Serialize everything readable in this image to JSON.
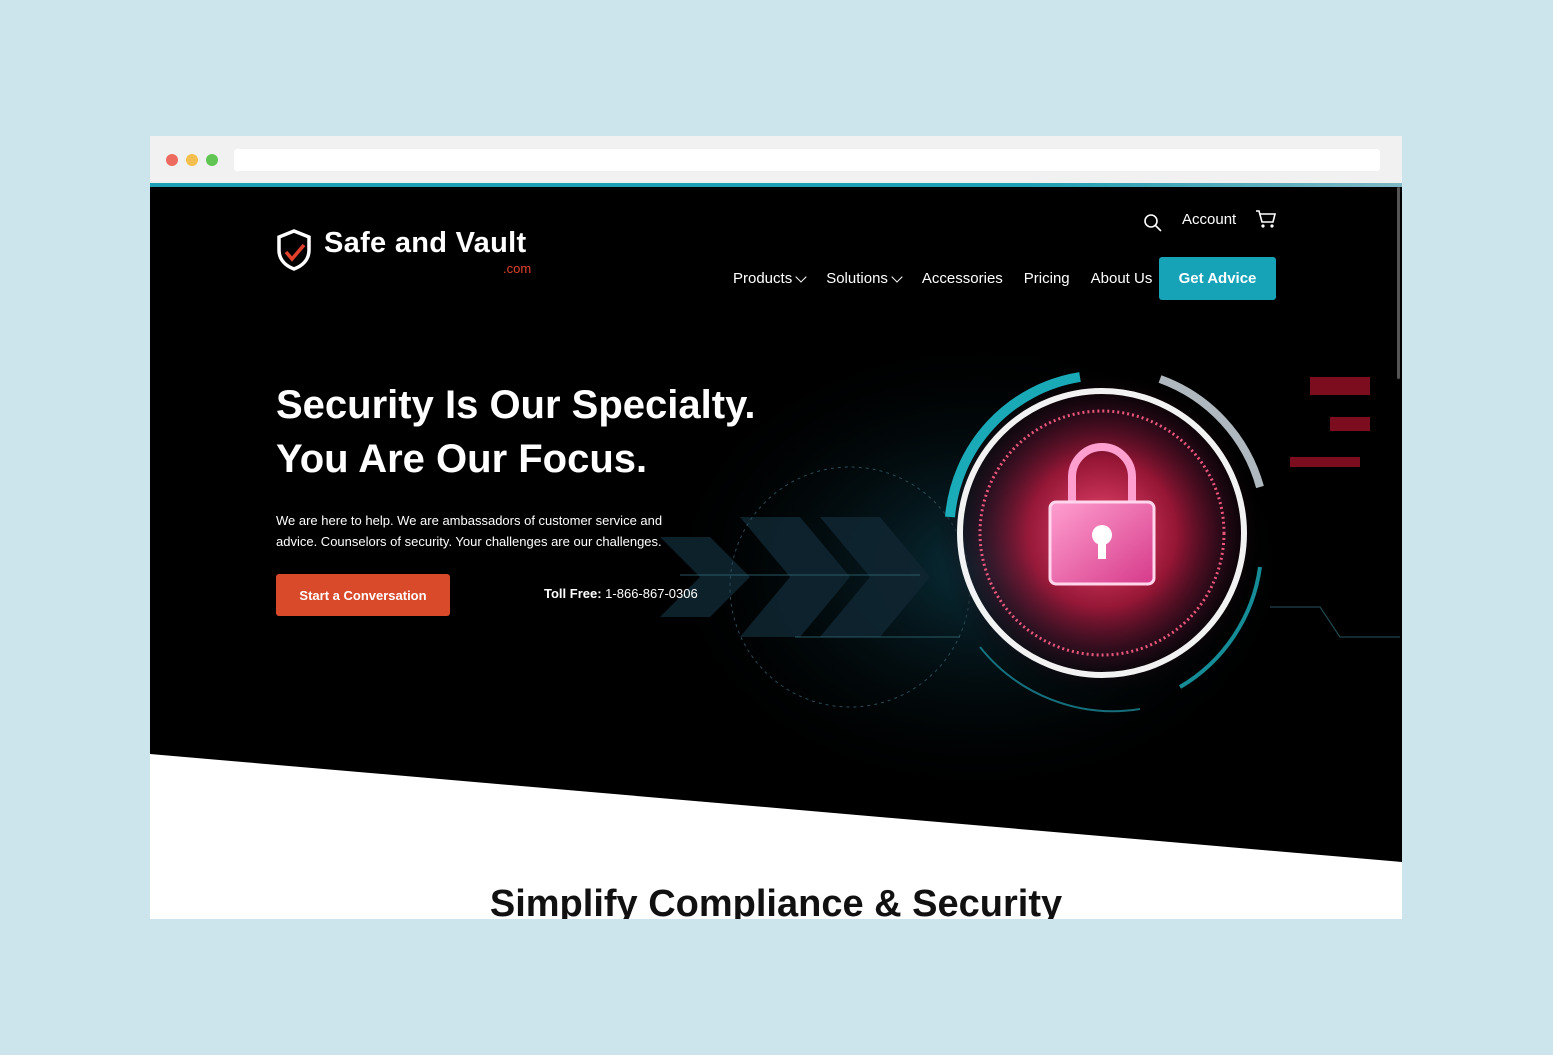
{
  "colors": {
    "page_background": "#cce5ec",
    "accent_teal": "#16a3b8",
    "accent_red": "#d94a2b",
    "hero_background": "#000000"
  },
  "header": {
    "logo": {
      "name": "Safe and Vault",
      "tld": ".com",
      "icon": "shield-check-icon"
    },
    "utility": {
      "search_icon": "search-icon",
      "account_label": "Account",
      "cart_icon": "cart-icon"
    },
    "nav": [
      {
        "label": "Products",
        "has_dropdown": true
      },
      {
        "label": "Solutions",
        "has_dropdown": true
      },
      {
        "label": "Accessories",
        "has_dropdown": false
      },
      {
        "label": "Pricing",
        "has_dropdown": false
      },
      {
        "label": "About Us",
        "has_dropdown": false
      }
    ],
    "cta_label": "Get Advice"
  },
  "hero": {
    "headline_line1": "Security Is Our Specialty.",
    "headline_line2": "You Are Our Focus.",
    "lede": "We are here to help. We are ambassadors of customer service and advice. Counselors of security. Your challenges are our challenges.",
    "cta_label": "Start a Conversation",
    "tollfree_label": "Toll Free:",
    "tollfree_number": "1-866-867-0306",
    "illustration": "padlock-illustration"
  },
  "next_section": {
    "title": "Simplify Compliance & Security"
  }
}
